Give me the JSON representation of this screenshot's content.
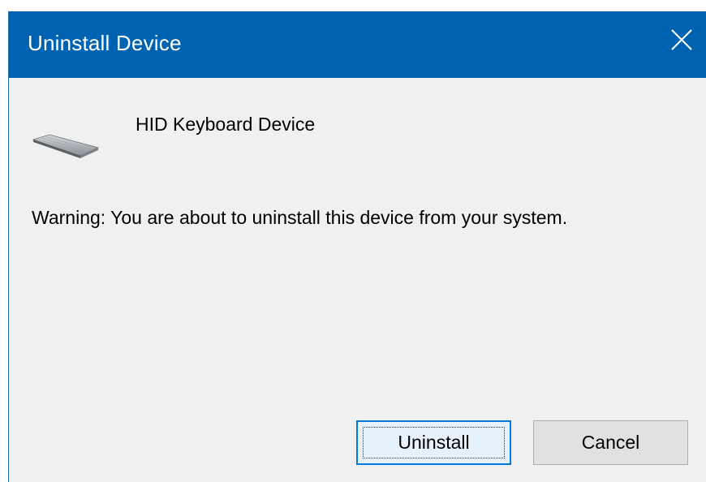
{
  "dialog": {
    "title": "Uninstall Device",
    "close_icon": "close-icon",
    "device_icon": "keyboard-icon",
    "device_name": "HID Keyboard Device",
    "warning": "Warning: You are about to uninstall this device from your system.",
    "buttons": {
      "uninstall": "Uninstall",
      "cancel": "Cancel"
    }
  },
  "colors": {
    "titlebar": "#0063b1",
    "body": "#f0f0f0",
    "focus_border": "#0078d7"
  }
}
